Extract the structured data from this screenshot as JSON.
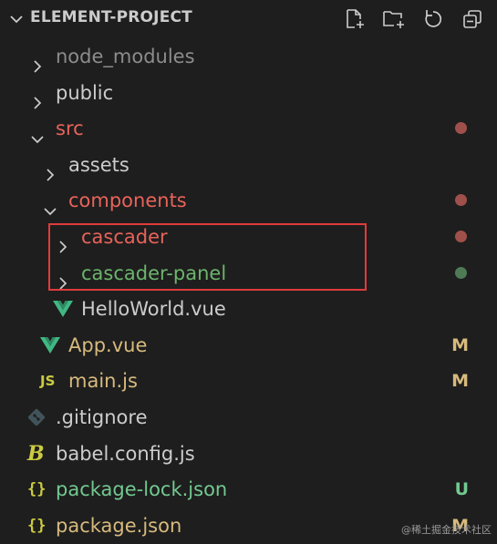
{
  "header": {
    "title": "ELEMENT-PROJECT",
    "actions": [
      "new-file-icon",
      "new-folder-icon",
      "refresh-icon",
      "collapse-all-icon"
    ]
  },
  "tree": [
    {
      "label": "node_modules",
      "type": "folder",
      "expanded": false,
      "depth": 1,
      "color": "#8c8c8c"
    },
    {
      "label": "public",
      "type": "folder",
      "expanded": false,
      "depth": 1,
      "color": "#cccccc"
    },
    {
      "label": "src",
      "type": "folder",
      "expanded": true,
      "depth": 1,
      "color": "#e8635a",
      "status_dot": "#a0504a"
    },
    {
      "label": "assets",
      "type": "folder",
      "expanded": false,
      "depth": 2,
      "color": "#cccccc"
    },
    {
      "label": "components",
      "type": "folder",
      "expanded": true,
      "depth": 2,
      "color": "#e8635a",
      "status_dot": "#a0504a"
    },
    {
      "label": "cascader",
      "type": "folder",
      "expanded": false,
      "depth": 3,
      "color": "#e8635a",
      "status_dot": "#a0504a"
    },
    {
      "label": "cascader-panel",
      "type": "folder",
      "expanded": false,
      "depth": 3,
      "color": "#6cb46c",
      "status_dot": "#4f7a56"
    },
    {
      "label": "HelloWorld.vue",
      "type": "file",
      "icon": "vue-icon",
      "depth": 3,
      "color": "#cccccc"
    },
    {
      "label": "App.vue",
      "type": "file",
      "icon": "vue-icon",
      "depth": 2,
      "color": "#d7ba7d",
      "badge": "M"
    },
    {
      "label": "main.js",
      "type": "file",
      "icon": "js-icon",
      "depth": 2,
      "color": "#d7ba7d",
      "badge": "M"
    },
    {
      "label": ".gitignore",
      "type": "file",
      "icon": "git-icon",
      "depth": 1,
      "color": "#cccccc"
    },
    {
      "label": "babel.config.js",
      "type": "file",
      "icon": "babel-icon",
      "depth": 1,
      "color": "#cccccc"
    },
    {
      "label": "package-lock.json",
      "type": "file",
      "icon": "json-icon",
      "depth": 1,
      "color": "#73c991",
      "badge": "U"
    },
    {
      "label": "package.json",
      "type": "file",
      "icon": "json-icon",
      "depth": 1,
      "color": "#d7ba7d",
      "badge": "M"
    }
  ],
  "colors": {
    "modified": "#d7ba7d",
    "untracked": "#73c991",
    "error": "#e8635a",
    "highlight_box": "#e03b3b"
  },
  "watermark": "@稀土掘金技术社区"
}
